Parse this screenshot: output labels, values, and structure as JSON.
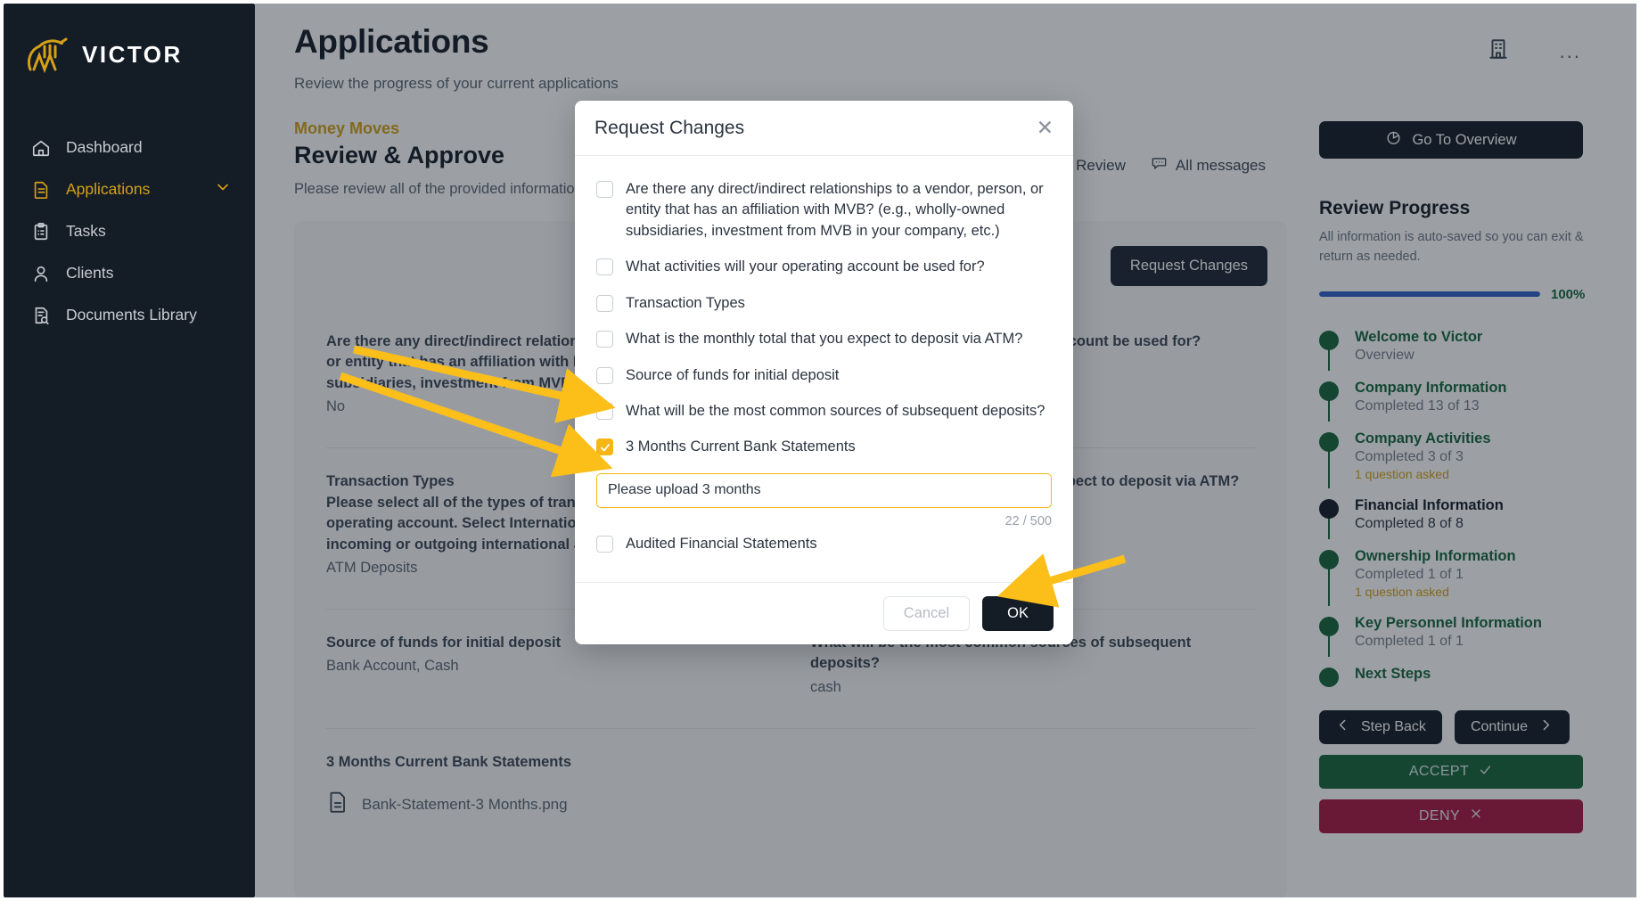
{
  "brand": {
    "name": "VICTOR",
    "accent": "#d4a017",
    "logo_icon": "victor-logo-icon"
  },
  "sidebar": {
    "items": [
      {
        "label": "Dashboard",
        "icon": "home-icon",
        "active": false
      },
      {
        "label": "Applications",
        "icon": "document-icon",
        "active": true,
        "chevron": "chevron-down-icon"
      },
      {
        "label": "Tasks",
        "icon": "clipboard-icon",
        "active": false
      },
      {
        "label": "Clients",
        "icon": "user-icon",
        "active": false
      },
      {
        "label": "Documents Library",
        "icon": "document-search-icon",
        "active": false
      }
    ]
  },
  "header": {
    "title": "Applications",
    "subtitle": "Review the progress of your current applications",
    "building_icon": "building-icon",
    "more_menu": "..."
  },
  "application": {
    "brand_crumb": "Money Moves",
    "section_title": "Review & Approve",
    "section_desc": "Please review all of the provided information",
    "status": "Under Review",
    "messages_label": "All messages",
    "messages_icon": "chat-icon",
    "request_changes_label": "Request Changes"
  },
  "questions": [
    {
      "label": "Are there any direct/indirect relationships to a vendor, person, or entity that has an affiliation with MVB? (e.g., wholly-owned subsidiaries, investment from MVB in your company, etc.)",
      "value": "No"
    },
    {
      "label": "What activities will your operating account be used for?",
      "value": ""
    },
    {
      "label": "Transaction Types\nPlease select all of the types of transactions you expect in the operating account. Select International if you expect any incoming or outgoing international activity.",
      "value": "ATM Deposits"
    },
    {
      "label": "What is the monthly total that you expect to deposit via ATM?",
      "value": ""
    },
    {
      "label": "Source of funds for initial deposit",
      "value": "Bank Account, Cash"
    },
    {
      "label": "What will be the most common sources of subsequent deposits?",
      "value": "cash"
    }
  ],
  "attachment": {
    "section_label": "3 Months Current Bank Statements",
    "file_name": "Bank-Statement-3 Months.png",
    "file_icon": "file-icon"
  },
  "rail": {
    "overview_button": "Go To Overview",
    "overview_icon": "pie-chart-icon",
    "title": "Review Progress",
    "note": "All information is auto-saved so you can exit & return as needed.",
    "progress_percent_label": "100%",
    "progress_percent": 100,
    "progress_color": "#2f5fc7",
    "steps": [
      {
        "name": "Welcome to Victor",
        "meta": "Overview",
        "question": "",
        "state": "done"
      },
      {
        "name": "Company Information",
        "meta": "Completed 13 of 13",
        "question": "",
        "state": "done"
      },
      {
        "name": "Company Activities",
        "meta": "Completed 3 of 3",
        "question": "1 question asked",
        "state": "done"
      },
      {
        "name": "Financial Information",
        "meta": "Completed 8 of 8",
        "question": "",
        "state": "current"
      },
      {
        "name": "Ownership Information",
        "meta": "Completed 1 of 1",
        "question": "1 question asked",
        "state": "done"
      },
      {
        "name": "Key Personnel Information",
        "meta": "Completed 1 of 1",
        "question": "",
        "state": "done"
      },
      {
        "name": "Next Steps",
        "meta": "",
        "question": "",
        "state": "done"
      }
    ],
    "step_back_label": "Step Back",
    "step_back_icon": "chevron-left-icon",
    "continue_label": "Continue",
    "continue_icon": "chevron-right-icon",
    "accept_label": "ACCEPT",
    "accept_icon": "check-icon",
    "accept_color": "#16653c",
    "deny_label": "DENY",
    "deny_icon": "x-icon",
    "deny_color": "#a81843"
  },
  "modal": {
    "title": "Request Changes",
    "close_icon": "close-icon",
    "options": [
      {
        "label": "Are there any direct/indirect relationships to a vendor, person, or entity that has an affiliation with MVB? (e.g., wholly-owned subsidiaries, investment from MVB in your company, etc.)",
        "checked": false
      },
      {
        "label": "What activities will your operating account be used for?",
        "checked": false
      },
      {
        "label": "Transaction Types",
        "checked": false
      },
      {
        "label": "What is the monthly total that you expect to deposit via ATM?",
        "checked": false
      },
      {
        "label": "Source of funds for initial deposit",
        "checked": false
      },
      {
        "label": "What will be the most common sources of subsequent deposits?",
        "checked": false
      },
      {
        "label": "3 Months Current Bank Statements",
        "checked": true
      },
      {
        "label": "Audited Financial Statements",
        "checked": false
      }
    ],
    "note_value": "Please upload 3 months",
    "note_placeholder": "",
    "counter": "22 / 500",
    "cancel_label": "Cancel",
    "ok_label": "OK"
  }
}
